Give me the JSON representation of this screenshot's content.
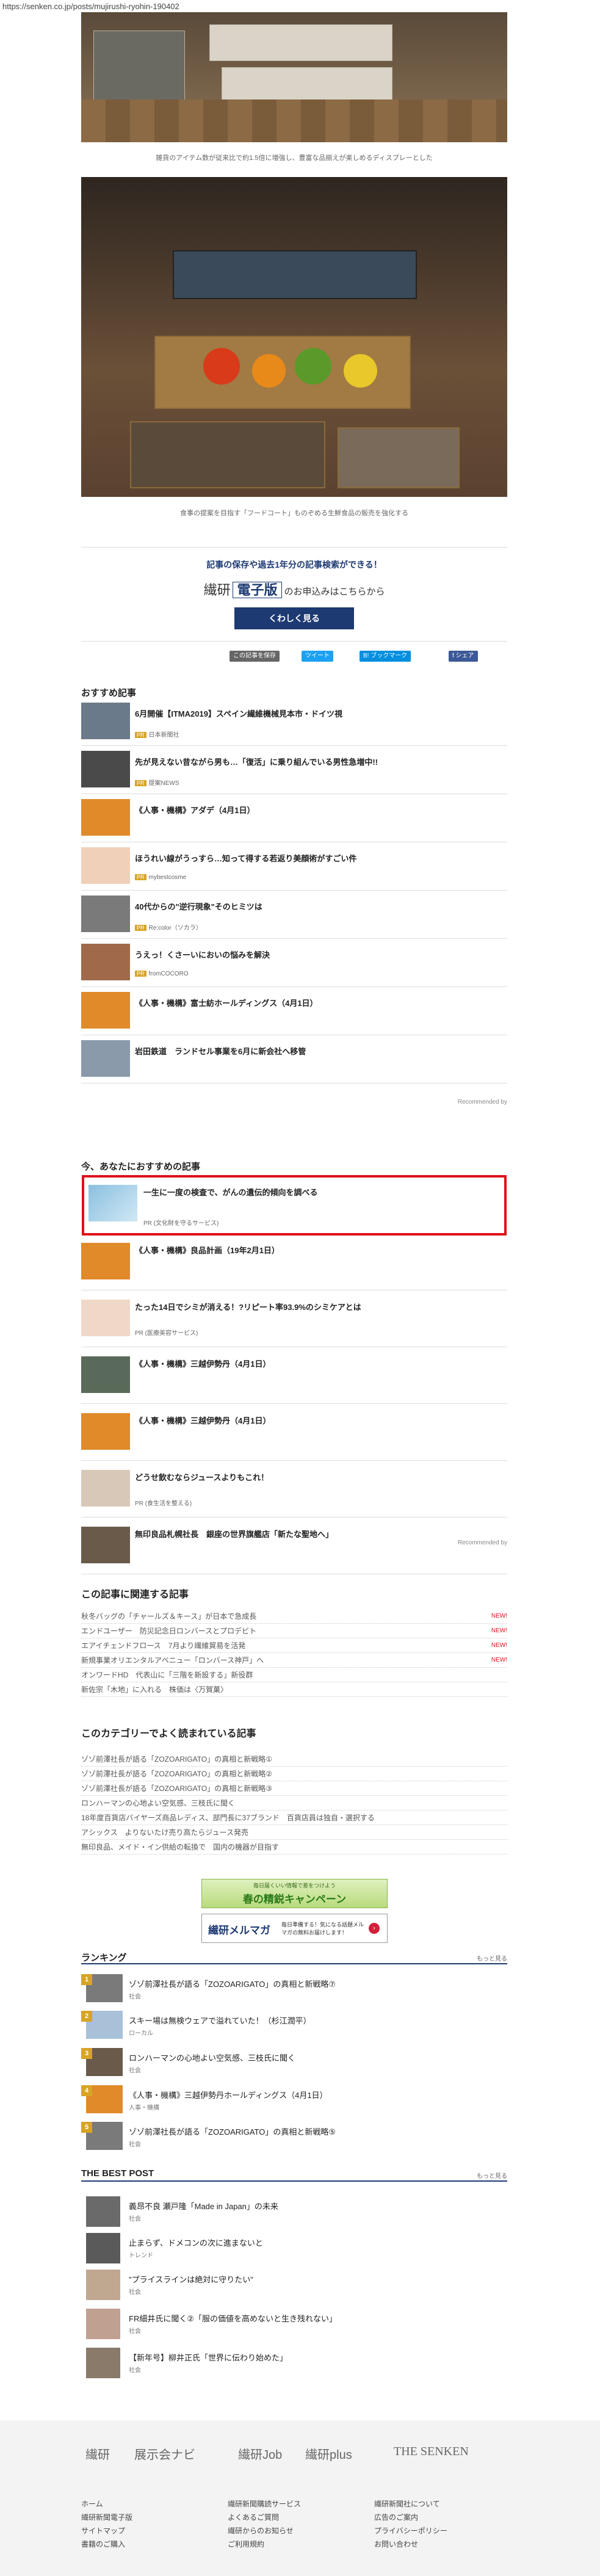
{
  "url": "https://senken.co.jp/posts/mujirushi-ryohin-190402",
  "captions": {
    "photo1": "雑貨のアイテム数が従来比で約1.5倍に増強し、豊富な品揃えが楽しめるディスプレーとした",
    "photo2": "食事の提案を目指す「フードコート」ものぞめる生鮮食品の販売を強化する"
  },
  "promo": {
    "lead": "記事の保存や過去1年分の記事検索ができる！",
    "brand_a": "繊研",
    "brand_e": "電子版",
    "brand_suffix": "のお申込みはこちらから",
    "button": "くわしく見る"
  },
  "share": {
    "save": "この記事を保存",
    "tweet": "ツイート",
    "hatena": "B! ブックマーク",
    "fb": "f シェア"
  },
  "osusume": {
    "title": "おすすめ記事",
    "recommended_by": "Recommended by",
    "items": [
      {
        "title": "6月開催【ITMA2019】スペイン繊維機械見本市・ドイツ視",
        "src": "日本新聞社",
        "pr": true
      },
      {
        "title": "先が見えない昔ながら男も…「復活」に乗り組んでいる男性急増中!!",
        "src": "提案NEWS",
        "pr": true
      },
      {
        "title": "《人事・機構》アダデ（4月1日）",
        "src": "",
        "pr": false
      },
      {
        "title": "ほうれい線がうっすら…知って得する若返り美顔術がすごい件",
        "src": "mybestcosme",
        "pr": true
      },
      {
        "title": "40代からの\"逆行現象\"そのヒミツは",
        "src": "Re:color（ソカラ）",
        "pr": true
      },
      {
        "title": "うえっ！くさーいにおいの悩みを解決",
        "src": "fromCOCORO",
        "pr": true
      },
      {
        "title": "《人事・機構》富士紡ホールディングス（4月1日）",
        "src": "",
        "pr": false
      },
      {
        "title": "岩田鉄道　ランドセル事業を6月に新会社へ移管",
        "src": "",
        "pr": false
      }
    ]
  },
  "anata": {
    "title": "今、あなたにおすすめの記事",
    "recommended_by": "Recommended by",
    "items": [
      {
        "title": "一生に一度の検査で、がんの遺伝的傾向を調べる",
        "src": "PR (文化財を守るサービス)"
      },
      {
        "title": "《人事・機構》良品計画（19年2月1日）",
        "src": ""
      },
      {
        "title": "たった14日でシミが消える！?リピート率93.9%のシミケアとは",
        "src": "PR (医療美容サービス)"
      },
      {
        "title": "《人事・機構》三越伊勢丹（4月1日）",
        "src": ""
      },
      {
        "title": "《人事・機構》三越伊勢丹（4月1日）",
        "src": ""
      },
      {
        "title": "どうせ飲むならジュースよりもこれ！",
        "src": "PR (食生活を整える)"
      },
      {
        "title": "無印良品札幌社長　銀座の世界旗艦店「新たな聖地へ」",
        "src": ""
      }
    ]
  },
  "related": {
    "title": "この記事に関連する記事",
    "items": [
      {
        "text": "秋冬バッグの「チャールズ＆キース」が日本で急成長",
        "new": "NEW!"
      },
      {
        "text": "エンドユーザー　防災記念日ロンバースとプロデビト",
        "new": "NEW!"
      },
      {
        "text": "エアイチェンドフロース　7月より繊維貿易を活発",
        "new": "NEW!"
      },
      {
        "text": "新規事業オリエンタルアベニュー「ロンバース神戸」へ",
        "new": "NEW!"
      },
      {
        "text": "オンワードHD　代表山に「三階を新設する」新役群",
        "new": ""
      },
      {
        "text": "新佐宗「木地」に入れる　株価は〈万賀菓〉",
        "new": ""
      }
    ]
  },
  "category": {
    "title": "このカテゴリーでよく読まれている記事",
    "items": [
      "ゾゾ前澤社長が語る「ZOZOARIGATO」の真相と新戦略①",
      "ゾゾ前澤社長が語る「ZOZOARIGATO」の真相と新戦略②",
      "ゾゾ前澤社長が語る「ZOZOARIGATO」の真相と新戦略③",
      "ロンハーマンの心地よい空気感、三枝氏に聞く",
      "18年度百貨店バイヤーズ商品レディス、部門長に37ブランド　百貨店員は独自・選択する",
      "アシックス　よりないたけ売り高たらジュース発売",
      "無印良品、メイド・イン供給の転換で　国内の機器が目指す"
    ]
  },
  "banners": {
    "spring": "春の精鋭キャンペーン",
    "spring_sub": "毎日届くいい情報で差をつけよう",
    "merumaga": "繊研メルマガ",
    "merumaga_desc": "毎日準備する！気になる話題メルマガの無料お届けします！",
    "arrow": "›"
  },
  "ranking": {
    "title": "ランキング",
    "more": "もっと見る",
    "items": [
      {
        "num": "1",
        "title": "ゾゾ前澤社長が語る「ZOZOARIGATO」の真相と新戦略⑦",
        "cat": "社会"
      },
      {
        "num": "2",
        "title": "スキー場は無検ウェアで溢れていた！（杉江潤平）",
        "cat": "ローカル"
      },
      {
        "num": "3",
        "title": "ロンハーマンの心地よい空気感、三枝氏に聞く",
        "cat": "社会"
      },
      {
        "num": "4",
        "title": "《人事・機構》三越伊勢丹ホールディングス（4月1日）",
        "cat": "人事・機構"
      },
      {
        "num": "5",
        "title": "ゾゾ前澤社長が語る「ZOZOARIGATO」の真相と新戦略⑤",
        "cat": "社会"
      }
    ]
  },
  "bestpost": {
    "title": "THE BEST POST",
    "more": "もっと見る",
    "items": [
      {
        "title": "義昂不良 瀬戸隆「Made in Japan」の未来",
        "cat": "社会"
      },
      {
        "title": "止まらず、ドメコンの次に進まないと",
        "cat": "トレンド"
      },
      {
        "title": "\"プライスラインは絶対に守りたい\"",
        "cat": "社会"
      },
      {
        "title": "FR細井氏に聞く②「服の価値を高めないと生き残れない」",
        "cat": "社会"
      },
      {
        "title": "【新年号】柳井正氏「世界に伝わり始めた」",
        "cat": "社会"
      }
    ]
  },
  "footer": {
    "logos": [
      "繊研",
      "展示会ナビ",
      "繊研Job",
      "繊研plus",
      "THE SENKEN"
    ],
    "col1": [
      "ホーム",
      "繊研新聞電子版",
      "サイトマップ",
      "書籍のご購入"
    ],
    "col2": [
      "繊研新聞購読サービス",
      "よくあるご質問",
      "繊研からのお知らせ",
      "ご利用規約"
    ],
    "col3": [
      "繊研新聞社について",
      "広告のご案内",
      "プライバシーポリシー",
      "お問い合わせ"
    ]
  },
  "colors": {
    "accent": "#1d3a72",
    "highlight": "#e0101a",
    "pr": "#d8a426"
  }
}
